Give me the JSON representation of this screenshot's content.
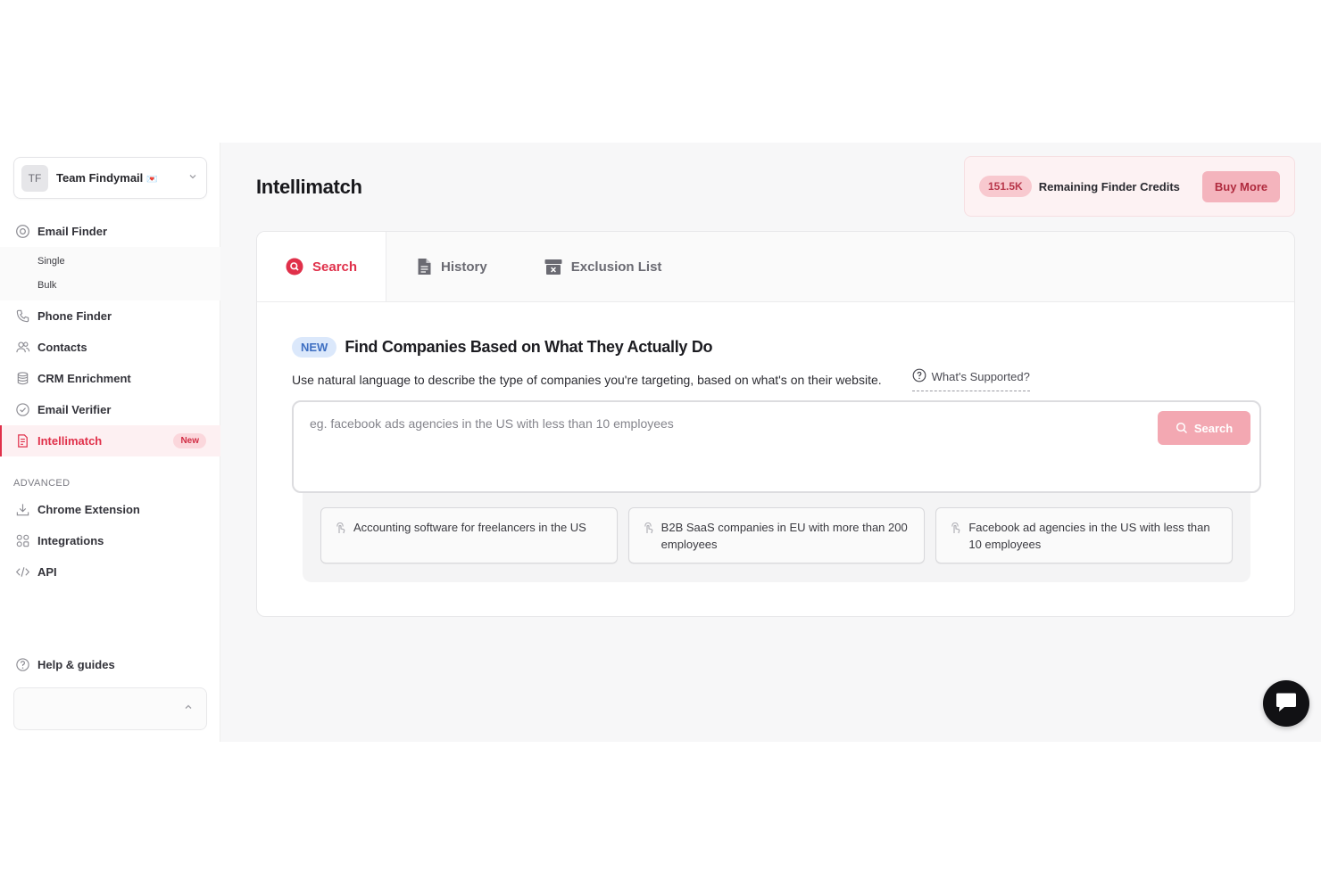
{
  "team": {
    "initials": "TF",
    "name": "Team Findymail",
    "emoji": "💌"
  },
  "nav": {
    "email_finder": "Email Finder",
    "single": "Single",
    "bulk": "Bulk",
    "phone_finder": "Phone Finder",
    "contacts": "Contacts",
    "crm_enrichment": "CRM Enrichment",
    "email_verifier": "Email Verifier",
    "intellimatch": "Intellimatch",
    "intellimatch_badge": "New",
    "advanced_label": "ADVANCED",
    "chrome_extension": "Chrome Extension",
    "integrations": "Integrations",
    "api": "API",
    "help": "Help & guides"
  },
  "page": {
    "title": "Intellimatch"
  },
  "credits": {
    "amount": "151.5K",
    "label": "Remaining Finder Credits",
    "buy_label": "Buy More"
  },
  "tabs": [
    {
      "label": "Search"
    },
    {
      "label": "History"
    },
    {
      "label": "Exclusion List"
    }
  ],
  "search": {
    "new_tag": "NEW",
    "headline": "Find Companies Based on What They Actually Do",
    "description": "Use natural language to describe the type of companies you're targeting, based on what's on their website.",
    "supported_link": "What's Supported?",
    "placeholder": "eg. facebook ads agencies in the US with less than 10 employees",
    "button_label": "Search"
  },
  "examples": [
    {
      "text": "Accounting software for freelancers in the US"
    },
    {
      "text": "B2B SaaS companies in EU with more than 200 employees"
    },
    {
      "text": "Facebook ad agencies in the US with less than 10 employees"
    }
  ],
  "colors": {
    "accent": "#e0304a",
    "badge_bg": "#f8c9cf",
    "new_blue": "#3e6fc2"
  }
}
